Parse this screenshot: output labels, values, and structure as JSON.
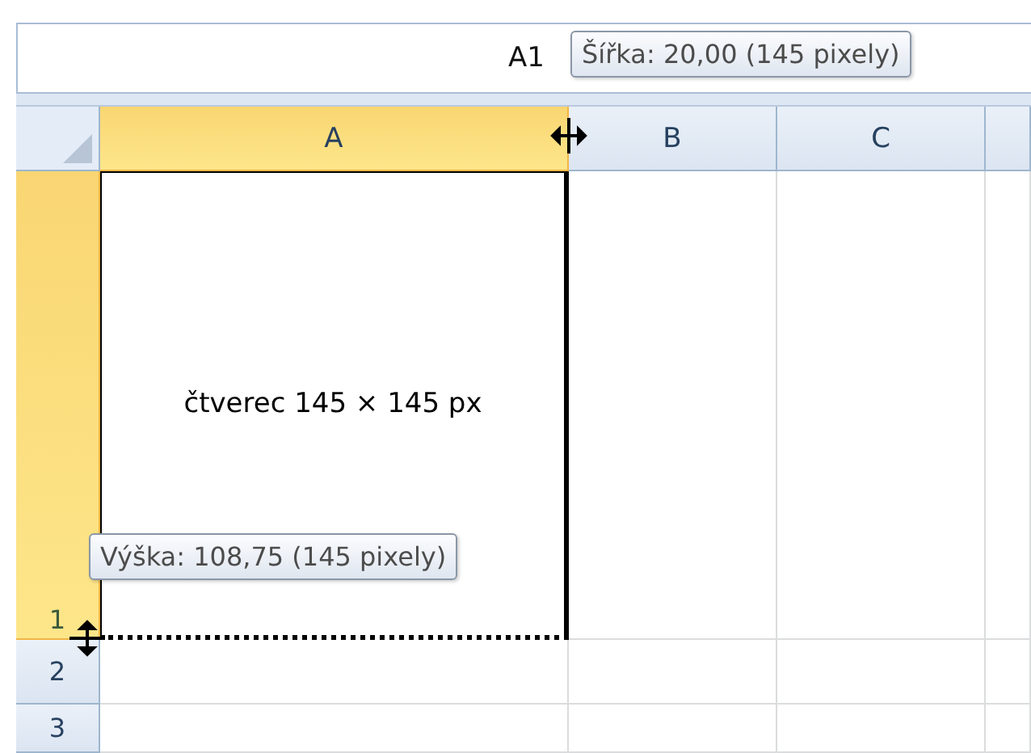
{
  "name_box": "A1",
  "width_tooltip": "Šířka: 20,00 (145 pixely)",
  "columns": [
    {
      "label": "A",
      "selected": true
    },
    {
      "label": "B",
      "selected": false
    },
    {
      "label": "C",
      "selected": false
    }
  ],
  "rows": [
    {
      "label": "1",
      "selected": true,
      "text": "čtverec 145 × 145 px"
    },
    {
      "label": "2",
      "selected": false
    },
    {
      "label": "3",
      "selected": false
    }
  ],
  "height_tooltip": "Výška: 108,75 (145 pixely)"
}
